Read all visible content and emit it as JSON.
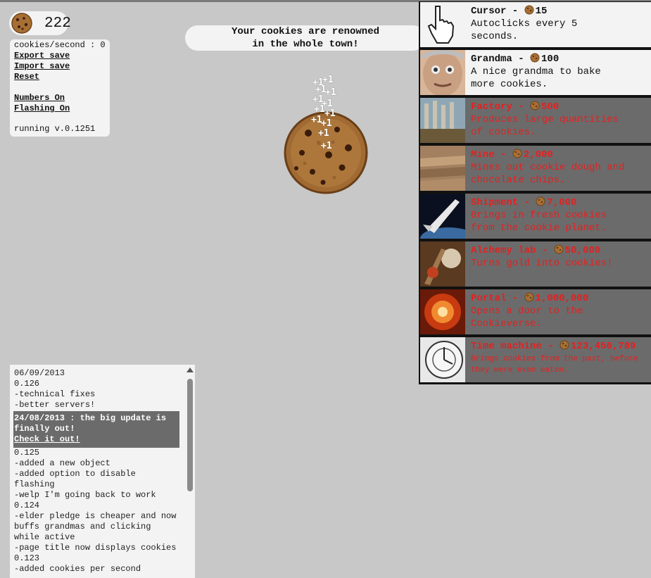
{
  "score": {
    "value": "222"
  },
  "stats": {
    "cps": "cookies/second : 0",
    "export": "Export save",
    "import": "Import save",
    "reset": "Reset",
    "numbers": "Numbers On",
    "flashing": "Flashing On",
    "version": "running v.0.1251"
  },
  "news": {
    "line1": "Your cookies are renowned",
    "line2": "in the whole town!"
  },
  "popups": {
    "text": "+1"
  },
  "store": {
    "items": [
      {
        "name": "Cursor - ",
        "price": "15",
        "desc1": "Autoclicks every 5",
        "desc2": "seconds.",
        "state": "afford",
        "icon": "cursor-hand-icon"
      },
      {
        "name": "Grandma - ",
        "price": "100",
        "desc1": "A nice grandma to bake",
        "desc2": "more cookies.",
        "state": "afford",
        "icon": "grandma-icon"
      },
      {
        "name": "Factory - ",
        "price": "500",
        "desc1": "Produces large quantities",
        "desc2": "of cookies.",
        "state": "locked",
        "icon": "factory-icon"
      },
      {
        "name": "Mine - ",
        "price": "2,000",
        "desc1": "Mines out cookie dough and",
        "desc2": "chocolate chips.",
        "state": "locked",
        "icon": "mine-icon"
      },
      {
        "name": "Shipment - ",
        "price": "7,000",
        "desc1": "Brings in fresh cookies",
        "desc2": "from the cookie planet.",
        "state": "locked",
        "icon": "shuttle-icon"
      },
      {
        "name": "Alchemy lab - ",
        "price": "50,000",
        "desc1": "Turns gold into cookies!",
        "desc2": "",
        "state": "locked",
        "icon": "alchemy-icon"
      },
      {
        "name": "Portal - ",
        "price": "1,000,000",
        "desc1": "Opens a door to the",
        "desc2": "Cookieverse.",
        "state": "locked",
        "icon": "portal-icon"
      },
      {
        "name": "Time machine - ",
        "price": "123,456,789",
        "desc1": "Brings cookies from the past, before",
        "desc2": "they were even eaten.",
        "state": "locked",
        "icon": "clock-icon"
      }
    ]
  },
  "changelog": {
    "lines": [
      "06/09/2013",
      "0.126",
      "-technical fixes",
      "-better servers!"
    ],
    "highlight1": "24/08/2013 : the big update is",
    "highlight2": "finally out!",
    "highlight_link": "Check it out!",
    "lines2": [
      "0.125",
      "-added a new object",
      "-added option to disable",
      "flashing",
      "-welp I'm going back to work",
      "0.124",
      "-elder pledge is cheaper and now",
      "buffs grandmas and clicking",
      "while active",
      "-page title now displays cookies",
      "0.123",
      "-added cookies per second"
    ]
  },
  "colors": {
    "background": "#c8c8c8",
    "panel": "#f3f3f3",
    "locked": "#6b6b6b",
    "locked_text": "#e52020"
  }
}
